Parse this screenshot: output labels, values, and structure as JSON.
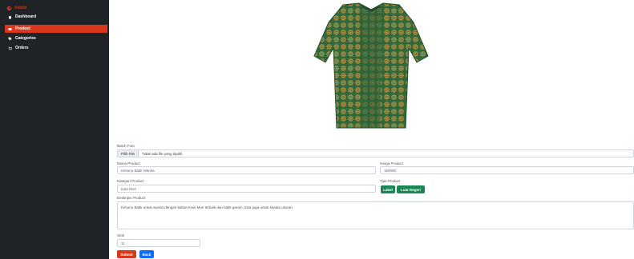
{
  "brand": {
    "label": "Admin",
    "color": "#d8391d"
  },
  "sidebar": {
    "items": [
      {
        "label": "Dashboard",
        "icon": "dashboard-icon",
        "active": false
      },
      {
        "label": "Product",
        "icon": "product-icon",
        "active": true
      },
      {
        "label": "Categories",
        "icon": "tag-icon",
        "active": false
      },
      {
        "label": "Orders",
        "icon": "cart-icon",
        "active": false
      }
    ]
  },
  "product_image": {
    "alt": "green patterned kimono"
  },
  "form": {
    "photo_label": "Batch Foto",
    "file_button": "Pilih File",
    "file_status": "Tidak ada file yang dipilih",
    "name_label": "Nama Product",
    "name_value": "Kimono Batik Wanita",
    "price_label": "Harga Product",
    "price_value": "150000",
    "category_label": "Kategori Product",
    "category_value": "Kain Mori",
    "type_label": "Tipe Product",
    "type_options": [
      "Label",
      "Luar Negeri"
    ],
    "description_label": "Deskripsi Product",
    "description_value": "Kimono Batik untuk wanita dengan bahan Kain Mori terbaik dan batik garam, bisa juga untuk kepala ukuran.",
    "stock_label": "Stok",
    "stock_value": "11",
    "submit_label": "Submit",
    "back_label": "Back"
  },
  "colors": {
    "sidebar_bg": "#1f2226",
    "accent": "#d8391d",
    "green": "#198754",
    "blue": "#0d6efd"
  }
}
